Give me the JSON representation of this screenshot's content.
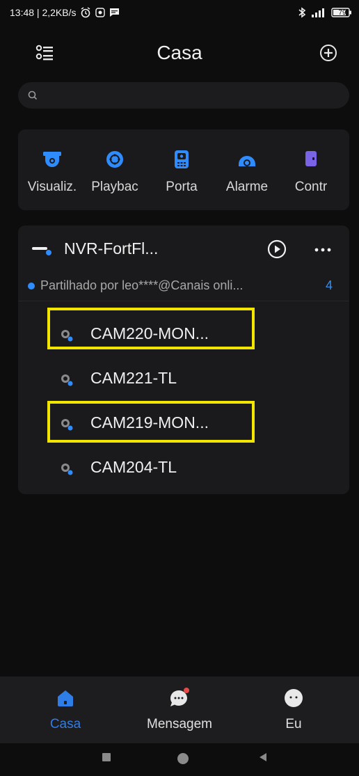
{
  "status_bar": {
    "time_info": "13:48 | 2,2KB/s",
    "battery": "79"
  },
  "header": {
    "title": "Casa"
  },
  "search": {
    "placeholder": ""
  },
  "quick_actions": [
    {
      "label": "Visualiz.",
      "icon": "camera-icon"
    },
    {
      "label": "Playbac",
      "icon": "playback-icon"
    },
    {
      "label": "Porta",
      "icon": "door-icon"
    },
    {
      "label": "Alarme",
      "icon": "alarm-icon"
    },
    {
      "label": "Contr",
      "icon": "access-control-icon"
    }
  ],
  "device": {
    "name": "NVR-FortFl...",
    "shared_text": "Partilhado por leo****@Canais onli...",
    "online_count": "4",
    "cameras": [
      {
        "label": "CAM220-MON...",
        "highlighted": true
      },
      {
        "label": "CAM221-TL",
        "highlighted": false
      },
      {
        "label": "CAM219-MON...",
        "highlighted": true
      },
      {
        "label": "CAM204-TL",
        "highlighted": false
      }
    ]
  },
  "bottom_nav": [
    {
      "label": "Casa",
      "active": true
    },
    {
      "label": "Mensagem",
      "active": false
    },
    {
      "label": "Eu",
      "active": false
    }
  ],
  "colors": {
    "accent": "#2f7de6",
    "highlight": "#f2e500",
    "card": "#1a1a1c"
  }
}
